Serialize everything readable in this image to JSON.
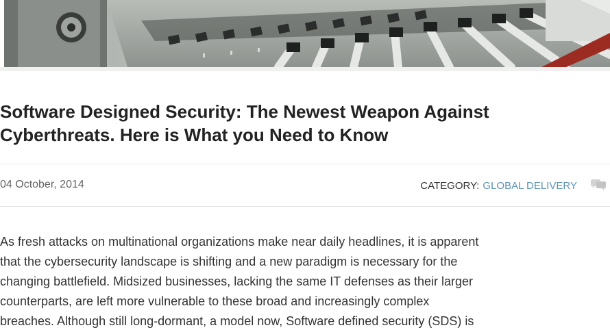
{
  "article": {
    "title_line1": "Software Designed Security: The Newest Weapon Against",
    "title_line2": "Cyberthreats. Here is What you Need to Know",
    "date": "04 October, 2014",
    "category_label": "CATEGORY:",
    "category_value": "GLOBAL DELIVERY",
    "body_lines": [
      "As fresh attacks on multinational organizations make near daily headlines, it is apparent",
      "that the cybersecurity landscape is shifting and a new paradigm is necessary for the",
      "changing battlefield. Midsized businesses, lacking the same IT defenses as their larger",
      "counterparts, are left more vulnerable to these broad and increasingly complex",
      "breaches. Although still long-dormant, a model now, Software defined security (SDS) is"
    ]
  },
  "colors": {
    "link": "#5b93b3",
    "title": "#222222",
    "muted": "#666666"
  },
  "icons": {
    "comment": "comment-bubbles-icon"
  }
}
